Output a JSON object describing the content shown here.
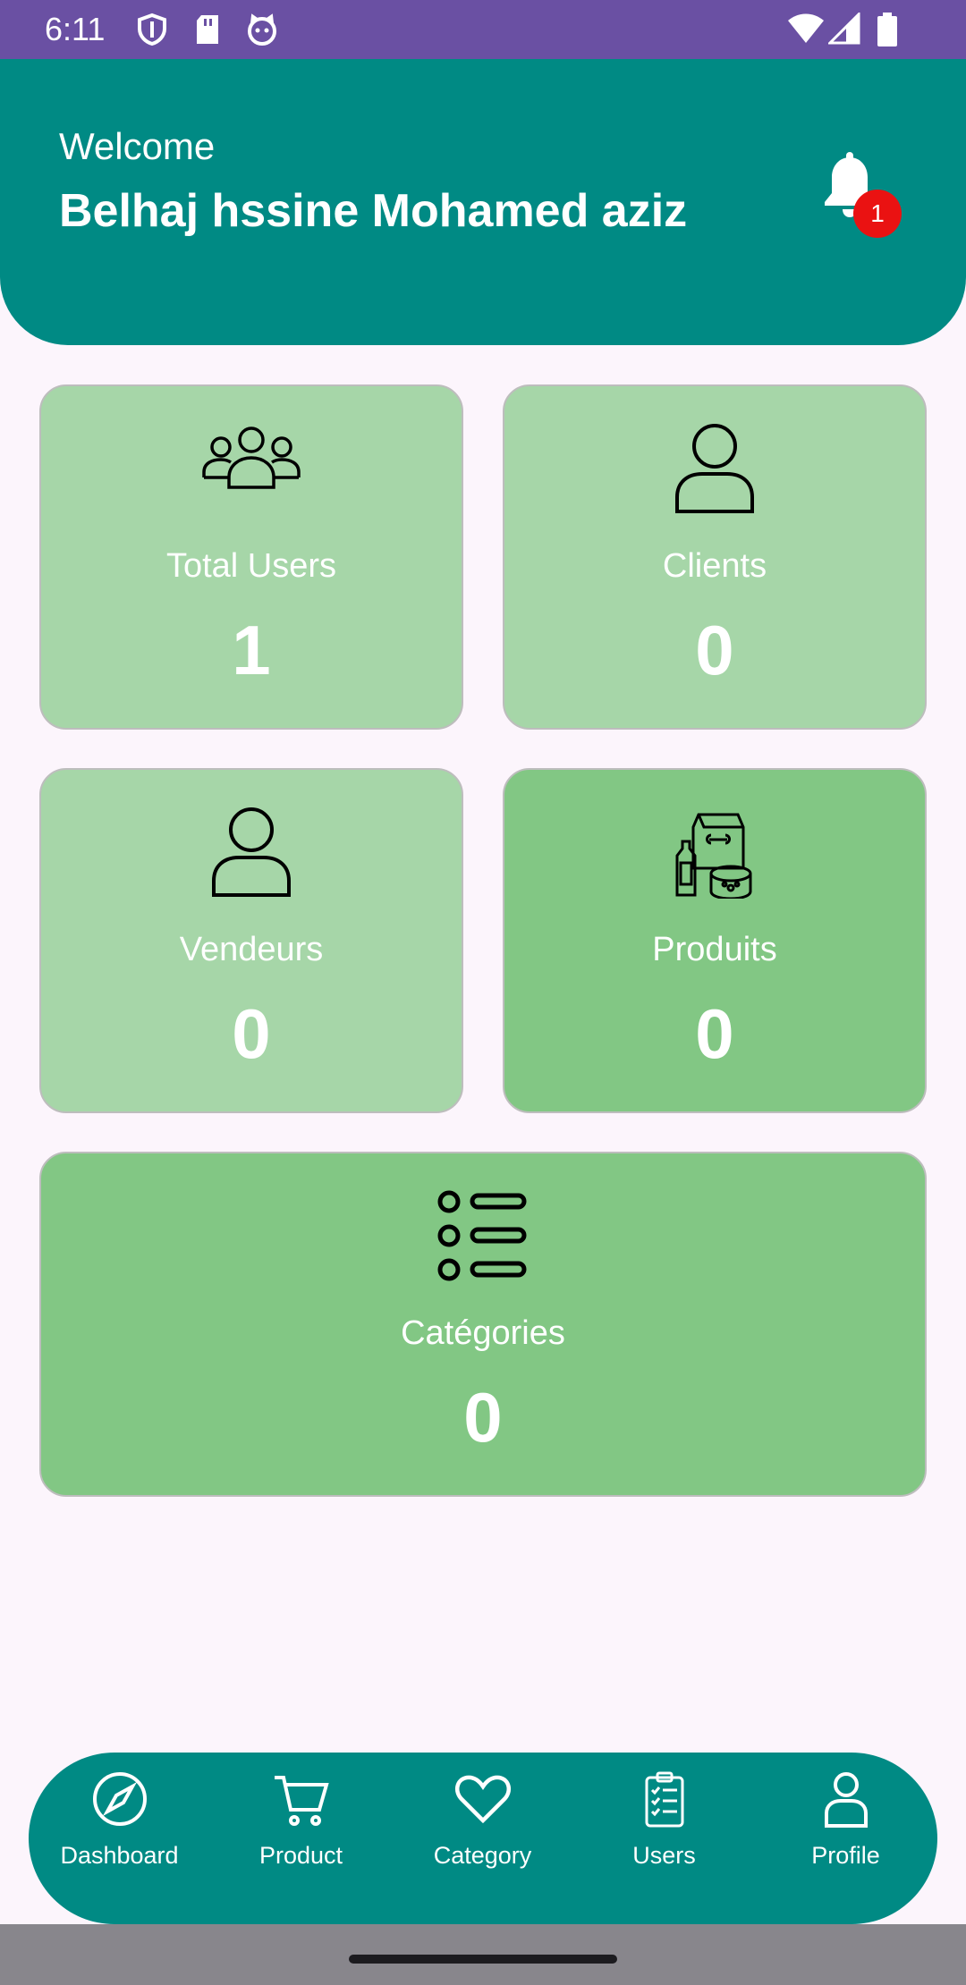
{
  "status_bar": {
    "time": "6:11",
    "icons": [
      "shield-icon",
      "sd-card-icon",
      "cat-icon",
      "wifi-icon",
      "signal-icon",
      "battery-icon"
    ]
  },
  "header": {
    "welcome": "Welcome",
    "name": "Belhaj hssine Mohamed aziz",
    "notification_count": "1"
  },
  "cards": {
    "total_users": {
      "label": "Total Users",
      "value": "1",
      "icon": "users-group-icon"
    },
    "clients": {
      "label": "Clients",
      "value": "0",
      "icon": "person-icon"
    },
    "vendeurs": {
      "label": "Vendeurs",
      "value": "0",
      "icon": "person-icon"
    },
    "produits": {
      "label": "Produits",
      "value": "0",
      "icon": "pet-products-icon"
    },
    "categories": {
      "label": "Catégories",
      "value": "0",
      "icon": "list-icon"
    }
  },
  "bottom_nav": [
    {
      "label": "Dashboard",
      "icon": "compass-icon"
    },
    {
      "label": "Product",
      "icon": "cart-icon"
    },
    {
      "label": "Category",
      "icon": "heart-icon"
    },
    {
      "label": "Users",
      "icon": "clipboard-icon"
    },
    {
      "label": "Profile",
      "icon": "profile-icon"
    }
  ],
  "colors": {
    "status_bar": "#6a50a3",
    "header": "#008a84",
    "card_light": "#a6d6a8",
    "card_medium": "#82c784",
    "badge": "#ea1212",
    "background": "#fcf5fc"
  }
}
